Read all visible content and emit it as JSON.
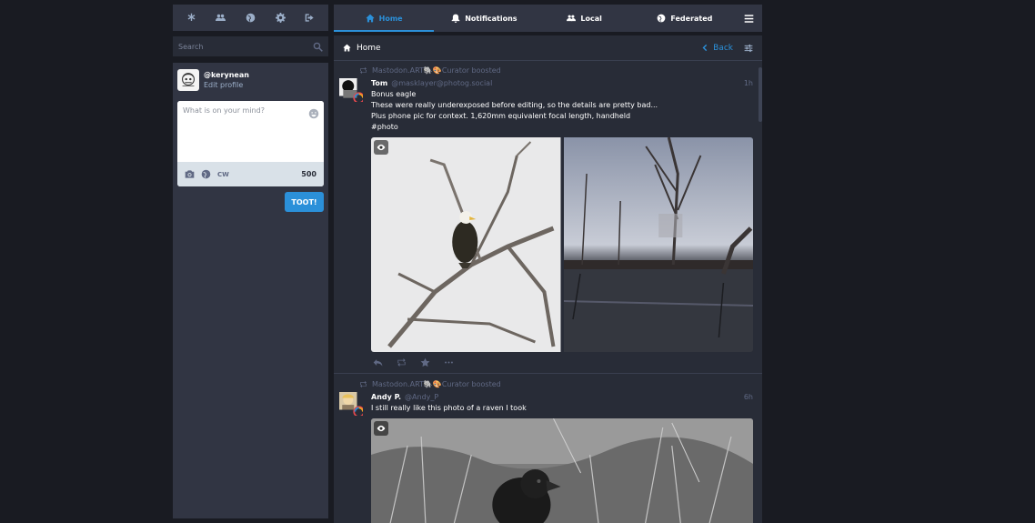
{
  "nav": {
    "icons": [
      "asterisk-icon",
      "users-icon",
      "globe-icon",
      "gear-icon",
      "sign-out-icon"
    ]
  },
  "search": {
    "placeholder": "Search"
  },
  "profile": {
    "handle": "@kerynean",
    "edit_label": "Edit profile"
  },
  "compose": {
    "placeholder": "What is on your mind?",
    "cw_label": "CW",
    "char_count": "500",
    "toot_label": "TOOT!"
  },
  "tabs": [
    {
      "label": "Home",
      "icon": "home-icon",
      "active": true
    },
    {
      "label": "Notifications",
      "icon": "bell-icon",
      "active": false
    },
    {
      "label": "Local",
      "icon": "users-icon",
      "active": false
    },
    {
      "label": "Federated",
      "icon": "globe-icon",
      "active": false
    }
  ],
  "column": {
    "title": "Home",
    "back_label": "Back"
  },
  "statuses": [
    {
      "boosted_by": "Mastodon.ART🐘🎨Curator boosted",
      "display_name": "Tom",
      "acct": "@masklayer@photog.social",
      "time": "1h",
      "lines": [
        "Bonus eagle",
        "These were really underexposed before editing, so the details are pretty bad...",
        "Plus phone pic for context. 1,620mm equivalent focal length, handheld",
        "#photo"
      ]
    },
    {
      "boosted_by": "Mastodon.ART🐘🎨Curator boosted",
      "display_name": "Andy P.",
      "acct": "@Andy_P",
      "time": "6h",
      "lines": [
        "I still really like this photo of a raven I took"
      ]
    }
  ],
  "colors": {
    "accent": "#2b90d9",
    "background": "#191b22",
    "panel": "#282c37",
    "panel_light": "#313543"
  }
}
